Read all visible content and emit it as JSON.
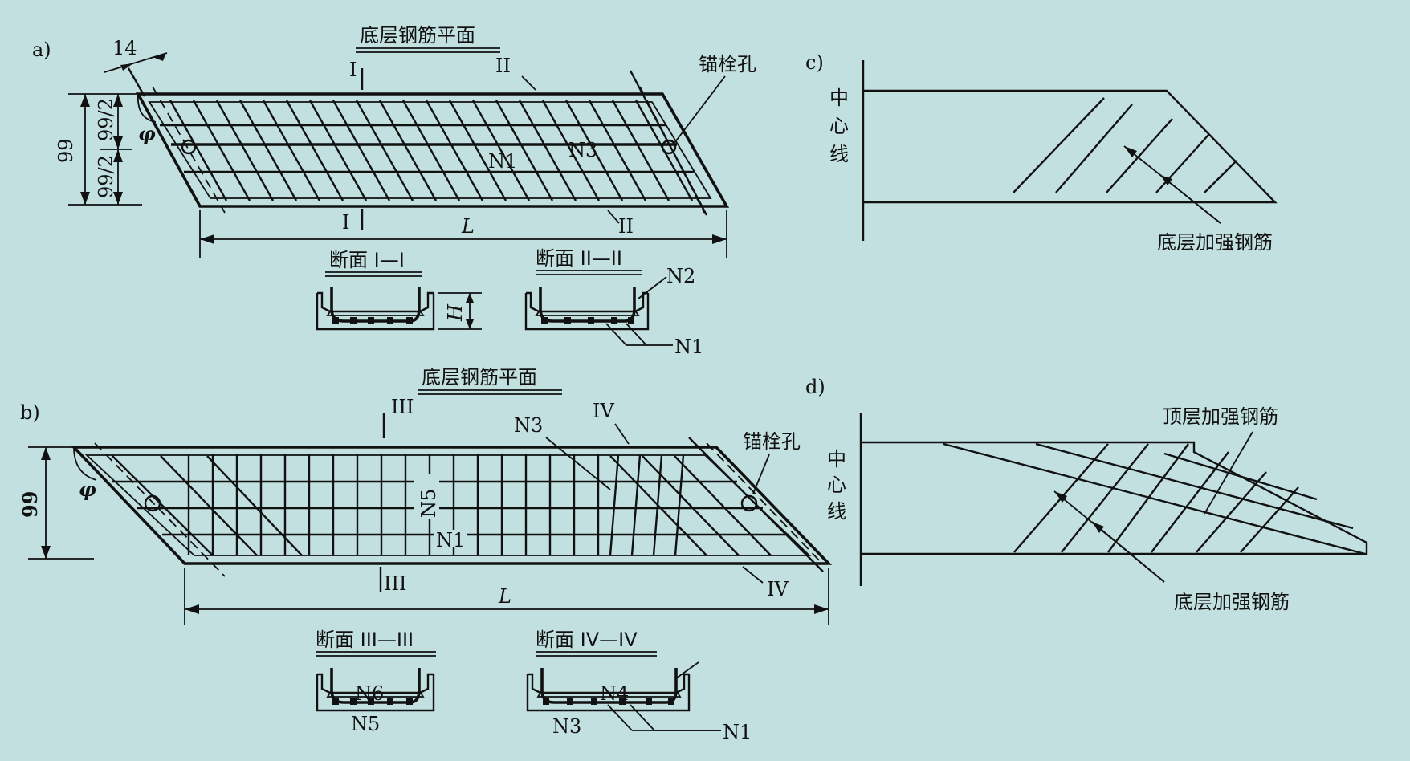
{
  "panels": {
    "a": {
      "tag": "a)",
      "title": "底层钢筋平面",
      "dim_top": "14",
      "dim_99": "99",
      "dim_half1": "99/2",
      "dim_half2": "99/2",
      "angle": "φ",
      "anchor": "锚栓孔",
      "sec1_top": "I",
      "sec1_bot": "I",
      "sec2_top": "II",
      "sec2_bot": "II",
      "bar_n1": "N1",
      "bar_n3": "N3",
      "length": "L",
      "section1_title": "断面 I—I",
      "section2_title": "断面 II—II",
      "height_label": "H",
      "sec_n2": "N2",
      "sec_n1": "N1"
    },
    "b": {
      "tag": "b)",
      "title": "底层钢筋平面",
      "dim_99": "99",
      "angle": "φ",
      "anchor": "锚栓孔",
      "sec3_top": "III",
      "sec3_bot": "III",
      "sec4_top": "IV",
      "sec4_bot": "IV",
      "bar_n3": "N3",
      "bar_n5": "N5",
      "bar_n1": "N1",
      "length": "L",
      "section3_title": "断面 III—III",
      "section4_title": "断面 IV—IV",
      "s3_n6": "N6",
      "s3_n5": "N5",
      "s4_n4": "N4",
      "s4_n3": "N3",
      "s4_n1": "N1"
    },
    "c": {
      "tag": "c)",
      "centerline": [
        "中",
        "心",
        "线"
      ],
      "bottom_rebar": "底层加强钢筋"
    },
    "d": {
      "tag": "d)",
      "centerline": [
        "中",
        "心",
        "线"
      ],
      "top_rebar": "顶层加强钢筋",
      "bottom_rebar": "底层加强钢筋"
    }
  },
  "colors": {
    "background": "#c2e0e0",
    "ink": "#111111"
  }
}
